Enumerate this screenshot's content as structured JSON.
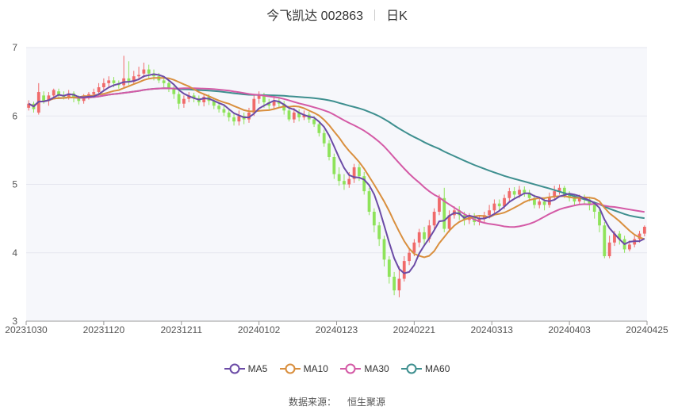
{
  "title": {
    "name": "今飞凯达 002863",
    "period": "日K"
  },
  "source": {
    "label": "数据来源：",
    "value": "恒生聚源"
  },
  "colors": {
    "up": "#f06a6a",
    "down": "#8ee35a",
    "MA5": "#6b4ba6",
    "MA10": "#d98f3e",
    "MA30": "#d45aa6",
    "MA60": "#3e8f8f",
    "plot_bg": "#f6f7fb",
    "grid": "#e6e7ef"
  },
  "chart_data": {
    "type": "candlestick",
    "ylim": [
      3,
      7
    ],
    "yticks": [
      "3",
      "4",
      "5",
      "6",
      "7"
    ],
    "xticks": [
      "20231030",
      "20231120",
      "20231211",
      "20240102",
      "20240123",
      "20240221",
      "20240313",
      "20240403",
      "20240425"
    ],
    "legend": [
      "MA5",
      "MA10",
      "MA30",
      "MA60"
    ],
    "legend_position": "bottom",
    "grid": true,
    "candles": [
      {
        "o": 6.12,
        "c": 6.18,
        "h": 6.23,
        "l": 6.08
      },
      {
        "o": 6.18,
        "c": 6.1,
        "h": 6.21,
        "l": 6.05
      },
      {
        "o": 6.05,
        "c": 6.35,
        "h": 6.48,
        "l": 6.02
      },
      {
        "o": 6.3,
        "c": 6.22,
        "h": 6.36,
        "l": 6.18
      },
      {
        "o": 6.22,
        "c": 6.3,
        "h": 6.35,
        "l": 6.15
      },
      {
        "o": 6.3,
        "c": 6.38,
        "h": 6.4,
        "l": 6.26
      },
      {
        "o": 6.36,
        "c": 6.3,
        "h": 6.4,
        "l": 6.26
      },
      {
        "o": 6.31,
        "c": 6.28,
        "h": 6.36,
        "l": 6.24
      },
      {
        "o": 6.28,
        "c": 6.33,
        "h": 6.38,
        "l": 6.24
      },
      {
        "o": 6.33,
        "c": 6.26,
        "h": 6.36,
        "l": 6.2
      },
      {
        "o": 6.26,
        "c": 6.22,
        "h": 6.3,
        "l": 6.17
      },
      {
        "o": 6.22,
        "c": 6.28,
        "h": 6.32,
        "l": 6.18
      },
      {
        "o": 6.28,
        "c": 6.32,
        "h": 6.35,
        "l": 6.24
      },
      {
        "o": 6.32,
        "c": 6.35,
        "h": 6.4,
        "l": 6.28
      },
      {
        "o": 6.35,
        "c": 6.42,
        "h": 6.48,
        "l": 6.3
      },
      {
        "o": 6.42,
        "c": 6.48,
        "h": 6.55,
        "l": 6.38
      },
      {
        "o": 6.48,
        "c": 6.52,
        "h": 6.58,
        "l": 6.42
      },
      {
        "o": 6.52,
        "c": 6.48,
        "h": 6.57,
        "l": 6.42
      },
      {
        "o": 6.48,
        "c": 6.45,
        "h": 6.52,
        "l": 6.4
      },
      {
        "o": 6.45,
        "c": 6.55,
        "h": 6.88,
        "l": 6.42
      },
      {
        "o": 6.55,
        "c": 6.5,
        "h": 6.8,
        "l": 6.45
      },
      {
        "o": 6.5,
        "c": 6.58,
        "h": 6.66,
        "l": 6.46
      },
      {
        "o": 6.58,
        "c": 6.6,
        "h": 6.72,
        "l": 6.52
      },
      {
        "o": 6.62,
        "c": 6.68,
        "h": 6.78,
        "l": 6.56
      },
      {
        "o": 6.68,
        "c": 6.62,
        "h": 6.75,
        "l": 6.55
      },
      {
        "o": 6.62,
        "c": 6.58,
        "h": 6.68,
        "l": 6.52
      },
      {
        "o": 6.58,
        "c": 6.52,
        "h": 6.63,
        "l": 6.48
      },
      {
        "o": 6.52,
        "c": 6.48,
        "h": 6.58,
        "l": 6.42
      },
      {
        "o": 6.48,
        "c": 6.4,
        "h": 6.52,
        "l": 6.35
      },
      {
        "o": 6.4,
        "c": 6.32,
        "h": 6.45,
        "l": 6.25
      },
      {
        "o": 6.32,
        "c": 6.18,
        "h": 6.36,
        "l": 6.1
      },
      {
        "o": 6.18,
        "c": 6.25,
        "h": 6.3,
        "l": 6.12
      },
      {
        "o": 6.25,
        "c": 6.3,
        "h": 6.35,
        "l": 6.2
      },
      {
        "o": 6.3,
        "c": 6.26,
        "h": 6.34,
        "l": 6.2
      },
      {
        "o": 6.26,
        "c": 6.2,
        "h": 6.3,
        "l": 6.15
      },
      {
        "o": 6.2,
        "c": 6.28,
        "h": 6.32,
        "l": 6.14
      },
      {
        "o": 6.28,
        "c": 6.22,
        "h": 6.32,
        "l": 6.16
      },
      {
        "o": 6.22,
        "c": 6.15,
        "h": 6.26,
        "l": 6.1
      },
      {
        "o": 6.15,
        "c": 6.1,
        "h": 6.2,
        "l": 6.05
      },
      {
        "o": 6.1,
        "c": 6.05,
        "h": 6.15,
        "l": 6.0
      },
      {
        "o": 6.05,
        "c": 5.98,
        "h": 6.1,
        "l": 5.92
      },
      {
        "o": 5.98,
        "c": 5.92,
        "h": 6.04,
        "l": 5.86
      },
      {
        "o": 5.92,
        "c": 6.0,
        "h": 6.08,
        "l": 5.86
      },
      {
        "o": 6.0,
        "c": 5.95,
        "h": 6.05,
        "l": 5.88
      },
      {
        "o": 5.95,
        "c": 6.05,
        "h": 6.12,
        "l": 5.9
      },
      {
        "o": 6.05,
        "c": 6.25,
        "h": 6.32,
        "l": 6.0
      },
      {
        "o": 6.25,
        "c": 6.3,
        "h": 6.36,
        "l": 6.18
      },
      {
        "o": 6.3,
        "c": 6.2,
        "h": 6.34,
        "l": 6.12
      },
      {
        "o": 6.2,
        "c": 6.15,
        "h": 6.25,
        "l": 6.1
      },
      {
        "o": 6.15,
        "c": 6.22,
        "h": 6.3,
        "l": 6.1
      },
      {
        "o": 6.22,
        "c": 6.18,
        "h": 6.28,
        "l": 6.12
      },
      {
        "o": 6.18,
        "c": 6.08,
        "h": 6.22,
        "l": 6.02
      },
      {
        "o": 6.08,
        "c": 5.95,
        "h": 6.12,
        "l": 5.92
      },
      {
        "o": 5.95,
        "c": 6.05,
        "h": 6.12,
        "l": 5.9
      },
      {
        "o": 6.05,
        "c": 5.98,
        "h": 6.1,
        "l": 5.92
      },
      {
        "o": 5.98,
        "c": 6.02,
        "h": 6.08,
        "l": 5.94
      },
      {
        "o": 6.02,
        "c": 5.95,
        "h": 6.06,
        "l": 5.9
      },
      {
        "o": 5.95,
        "c": 5.88,
        "h": 6.0,
        "l": 5.84
      },
      {
        "o": 5.88,
        "c": 5.75,
        "h": 5.92,
        "l": 5.7
      },
      {
        "o": 5.75,
        "c": 5.6,
        "h": 5.8,
        "l": 5.55
      },
      {
        "o": 5.6,
        "c": 5.4,
        "h": 5.65,
        "l": 5.35
      },
      {
        "o": 5.4,
        "c": 5.15,
        "h": 5.45,
        "l": 5.08
      },
      {
        "o": 5.15,
        "c": 5.05,
        "h": 5.25,
        "l": 4.98
      },
      {
        "o": 5.05,
        "c": 5.0,
        "h": 5.15,
        "l": 4.92
      },
      {
        "o": 5.0,
        "c": 5.08,
        "h": 5.18,
        "l": 4.95
      },
      {
        "o": 5.08,
        "c": 5.25,
        "h": 5.3,
        "l": 5.02
      },
      {
        "o": 5.25,
        "c": 5.12,
        "h": 5.3,
        "l": 5.05
      },
      {
        "o": 5.12,
        "c": 4.9,
        "h": 5.18,
        "l": 4.85
      },
      {
        "o": 4.9,
        "c": 4.6,
        "h": 4.95,
        "l": 4.55
      },
      {
        "o": 4.6,
        "c": 4.4,
        "h": 4.65,
        "l": 4.3
      },
      {
        "o": 4.4,
        "c": 4.2,
        "h": 4.45,
        "l": 4.1
      },
      {
        "o": 4.2,
        "c": 3.9,
        "h": 4.25,
        "l": 3.8
      },
      {
        "o": 3.9,
        "c": 3.65,
        "h": 3.95,
        "l": 3.55
      },
      {
        "o": 3.65,
        "c": 3.45,
        "h": 3.72,
        "l": 3.38
      },
      {
        "o": 3.45,
        "c": 3.62,
        "h": 3.8,
        "l": 3.35
      },
      {
        "o": 3.62,
        "c": 3.88,
        "h": 3.95,
        "l": 3.58
      },
      {
        "o": 3.88,
        "c": 4.0,
        "h": 4.05,
        "l": 3.82
      },
      {
        "o": 4.0,
        "c": 4.15,
        "h": 4.2,
        "l": 3.95
      },
      {
        "o": 4.15,
        "c": 4.3,
        "h": 4.35,
        "l": 4.08
      },
      {
        "o": 4.3,
        "c": 4.2,
        "h": 4.38,
        "l": 4.12
      },
      {
        "o": 4.2,
        "c": 4.4,
        "h": 4.48,
        "l": 4.15
      },
      {
        "o": 4.4,
        "c": 4.6,
        "h": 4.65,
        "l": 4.35
      },
      {
        "o": 4.6,
        "c": 4.8,
        "h": 4.85,
        "l": 4.55
      },
      {
        "o": 4.8,
        "c": 4.35,
        "h": 4.95,
        "l": 4.3
      },
      {
        "o": 4.35,
        "c": 4.55,
        "h": 4.62,
        "l": 4.3
      },
      {
        "o": 4.55,
        "c": 4.62,
        "h": 4.68,
        "l": 4.5
      },
      {
        "o": 4.62,
        "c": 4.55,
        "h": 4.68,
        "l": 4.48
      },
      {
        "o": 4.55,
        "c": 4.48,
        "h": 4.6,
        "l": 4.4
      },
      {
        "o": 4.48,
        "c": 4.52,
        "h": 4.58,
        "l": 4.42
      },
      {
        "o": 4.52,
        "c": 4.45,
        "h": 4.58,
        "l": 4.4
      },
      {
        "o": 4.45,
        "c": 4.5,
        "h": 4.55,
        "l": 4.4
      },
      {
        "o": 4.5,
        "c": 4.55,
        "h": 4.6,
        "l": 4.45
      },
      {
        "o": 4.55,
        "c": 4.62,
        "h": 4.7,
        "l": 4.5
      },
      {
        "o": 4.62,
        "c": 4.72,
        "h": 4.78,
        "l": 4.58
      },
      {
        "o": 4.72,
        "c": 4.68,
        "h": 4.78,
        "l": 4.62
      },
      {
        "o": 4.68,
        "c": 4.8,
        "h": 4.85,
        "l": 4.64
      },
      {
        "o": 4.8,
        "c": 4.9,
        "h": 4.95,
        "l": 4.75
      },
      {
        "o": 4.9,
        "c": 4.85,
        "h": 4.96,
        "l": 4.8
      },
      {
        "o": 4.85,
        "c": 4.92,
        "h": 4.98,
        "l": 4.8
      },
      {
        "o": 4.92,
        "c": 4.88,
        "h": 4.97,
        "l": 4.82
      },
      {
        "o": 4.88,
        "c": 4.8,
        "h": 4.92,
        "l": 4.75
      },
      {
        "o": 4.8,
        "c": 4.7,
        "h": 4.85,
        "l": 4.65
      },
      {
        "o": 4.7,
        "c": 4.75,
        "h": 4.8,
        "l": 4.65
      },
      {
        "o": 4.75,
        "c": 4.7,
        "h": 4.8,
        "l": 4.62
      },
      {
        "o": 4.7,
        "c": 4.82,
        "h": 4.88,
        "l": 4.66
      },
      {
        "o": 4.82,
        "c": 4.9,
        "h": 4.98,
        "l": 4.78
      },
      {
        "o": 4.9,
        "c": 4.95,
        "h": 5.0,
        "l": 4.85
      },
      {
        "o": 4.95,
        "c": 4.85,
        "h": 4.98,
        "l": 4.8
      },
      {
        "o": 4.85,
        "c": 4.8,
        "h": 4.9,
        "l": 4.75
      },
      {
        "o": 4.8,
        "c": 4.75,
        "h": 4.85,
        "l": 4.7
      },
      {
        "o": 4.75,
        "c": 4.8,
        "h": 4.85,
        "l": 4.7
      },
      {
        "o": 4.8,
        "c": 4.78,
        "h": 4.85,
        "l": 4.72
      },
      {
        "o": 4.78,
        "c": 4.7,
        "h": 4.82,
        "l": 4.62
      },
      {
        "o": 4.7,
        "c": 4.6,
        "h": 4.75,
        "l": 4.5
      },
      {
        "o": 4.6,
        "c": 4.4,
        "h": 4.65,
        "l": 4.3
      },
      {
        "o": 4.4,
        "c": 3.95,
        "h": 4.45,
        "l": 3.92
      },
      {
        "o": 3.95,
        "c": 4.15,
        "h": 4.25,
        "l": 3.92
      },
      {
        "o": 4.15,
        "c": 4.28,
        "h": 4.32,
        "l": 4.1
      },
      {
        "o": 4.28,
        "c": 4.2,
        "h": 4.32,
        "l": 4.12
      },
      {
        "o": 4.2,
        "c": 4.05,
        "h": 4.25,
        "l": 4.0
      },
      {
        "o": 4.05,
        "c": 4.12,
        "h": 4.18,
        "l": 4.02
      },
      {
        "o": 4.12,
        "c": 4.2,
        "h": 4.25,
        "l": 4.08
      },
      {
        "o": 4.2,
        "c": 4.28,
        "h": 4.32,
        "l": 4.15
      },
      {
        "o": 4.28,
        "c": 4.38,
        "h": 4.4,
        "l": 4.24
      }
    ]
  }
}
